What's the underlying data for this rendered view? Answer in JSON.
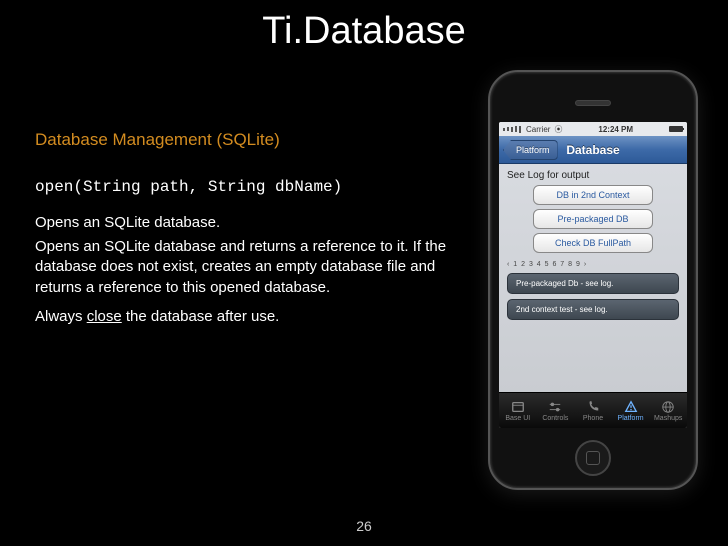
{
  "title": "Ti.Database",
  "subheading": "Database Management (SQLite)",
  "signature": "open(String path, String dbName)",
  "desc1": "Opens an SQLite database.",
  "desc2": "Opens an SQLite database and returns a reference to it. If the database does not exist, creates an empty database file and returns a reference to this opened database.",
  "desc3_pre": "Always ",
  "desc3_u": "close",
  "desc3_post": " the database after use.",
  "page_number": "26",
  "phone": {
    "carrier": "Carrier",
    "wifi": "",
    "time": "12:24 PM",
    "back": "Platform",
    "nav_title": "Database",
    "log_label": "See Log for output",
    "buttons": [
      "DB in 2nd Context",
      "Pre-packaged DB",
      "Check DB FullPath"
    ],
    "pager": "‹ 1 2 3 4 5 6 7 8 9 ›",
    "logs": [
      "Pre-packaged Db - see log.",
      "2nd context test - see log."
    ],
    "tabs": [
      "Base UI",
      "Controls",
      "Phone",
      "Platform",
      "Mashups"
    ],
    "active_tab": 3
  }
}
